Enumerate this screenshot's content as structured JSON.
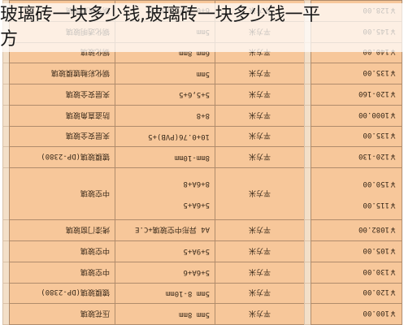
{
  "title": {
    "line1": "玻璃砖一块多少钱,玻璃砖一块多少钱一平",
    "line2": "方"
  },
  "table": {
    "rows": [
      {
        "price": "￥100.00",
        "unit": "平方米",
        "spec": "5mm 8mm",
        "name": "压花玻璃"
      },
      {
        "price": "￥120.00",
        "unit": "平方米",
        "spec": "5mm 8-10mm",
        "name": "镀膜玻璃(DP-2380)"
      },
      {
        "price": "￥130.00",
        "unit": "平方米",
        "spec": "5+6A+6",
        "name": "中空玻璃"
      },
      {
        "price": "￥105.00",
        "unit": "平方米",
        "spec": "5+9A+5",
        "name": "中空玻璃"
      },
      {
        "price": "￥1082.00",
        "unit": "平方米",
        "spec": "A4 异形中空玻璃+C.E",
        "name": "烤漆门窗玻璃"
      },
      {
        "price_lines": [
          "￥115.00",
          "￥150.00"
        ],
        "unit": "平方米",
        "spec_lines": [
          "5+6A+5",
          "8+6A+8"
        ],
        "name": "中空玻璃",
        "tall": true
      },
      {
        "price": "￥120-130",
        "unit": "平方米",
        "spec": "8mm-10mm",
        "name": "镀膜玻璃(DP-2380)"
      },
      {
        "price": "￥135.00",
        "unit": "平方米",
        "spec": "10+0.76(PVB)+5",
        "name": "夹层安全玻璃"
      },
      {
        "price": "￥1000.00",
        "unit": "平方米",
        "spec": "8+8",
        "name": "防盗直角玻璃"
      },
      {
        "price": "￥120-160",
        "unit": "平方米",
        "spec": "5+5,6+5",
        "name": "夹层安全玻璃"
      },
      {
        "price": "￥135.00",
        "unit": "平方米",
        "spec": "5mm",
        "name": "钢化彩釉镀膜玻璃"
      },
      {
        "price": "￥140.00",
        "unit": "平方米",
        "spec": "6mm 8mm",
        "name": "钢化玻璃"
      },
      {
        "price": "￥145.00",
        "unit": "平方米",
        "spec": "5mm",
        "name": "钢化透明玻璃"
      },
      {
        "price": "￥128.00",
        "unit": "平方米",
        "spec": "6+0.38PVB+3夹胶",
        "name": "钢化夹层玻璃"
      }
    ]
  }
}
